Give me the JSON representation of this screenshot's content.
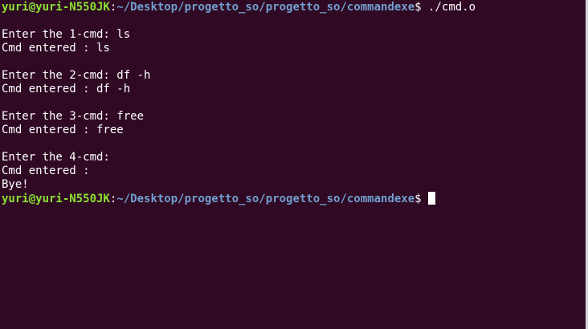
{
  "terminal": {
    "prompt": {
      "user_host": "yuri@yuri-N550JK",
      "colon": ":",
      "path": "~/Desktop/progetto_so/progetto_so/commandexe",
      "symbol": "$ "
    },
    "first_command": "./cmd.o",
    "output": [
      "",
      "Enter the 1-cmd: ls",
      "Cmd entered : ls",
      "",
      "Enter the 2-cmd: df -h",
      "Cmd entered : df -h",
      "",
      "Enter the 3-cmd: free",
      "Cmd entered : free",
      "",
      "Enter the 4-cmd: ",
      "Cmd entered : ",
      "Bye!"
    ],
    "colors": {
      "background": "#300a24",
      "user": "#8ae234",
      "path": "#729fcf",
      "text": "#ffffff"
    }
  }
}
